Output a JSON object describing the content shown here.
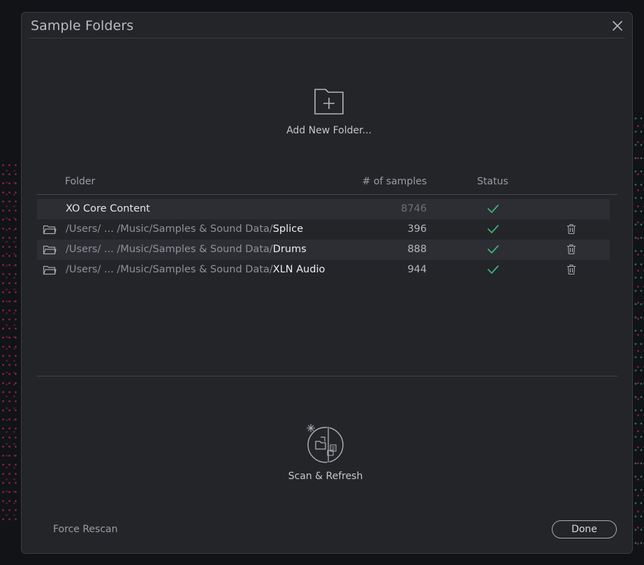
{
  "dialog": {
    "title": "Sample Folders"
  },
  "add_folder": {
    "label": "Add New Folder..."
  },
  "table": {
    "headers": {
      "folder": "Folder",
      "samples": "# of samples",
      "status": "Status"
    },
    "rows": [
      {
        "prefix": "",
        "leaf": "XO Core Content",
        "count": "8746",
        "status": "ok",
        "deletable": false
      },
      {
        "prefix": "/Users/ ... /Music/Samples & Sound Data/",
        "leaf": "Splice",
        "count": "396",
        "status": "ok",
        "deletable": true
      },
      {
        "prefix": "/Users/ ... /Music/Samples & Sound Data/",
        "leaf": "Drums",
        "count": "888",
        "status": "ok",
        "deletable": true
      },
      {
        "prefix": "/Users/ ... /Music/Samples & Sound Data/",
        "leaf": "XLN Audio",
        "count": "944",
        "status": "ok",
        "deletable": true
      }
    ]
  },
  "scan": {
    "label": "Scan & Refresh"
  },
  "footer": {
    "force_rescan": "Force Rescan",
    "done": "Done"
  },
  "colors": {
    "accent_check": "#3fb077",
    "dialog_bg": "#232529"
  },
  "icons": {
    "close": "close-icon",
    "add_folder": "folder-plus-icon",
    "folder": "folder-open-icon",
    "check": "check-icon",
    "delete": "trash-icon",
    "scan": "scan-refresh-icon"
  }
}
